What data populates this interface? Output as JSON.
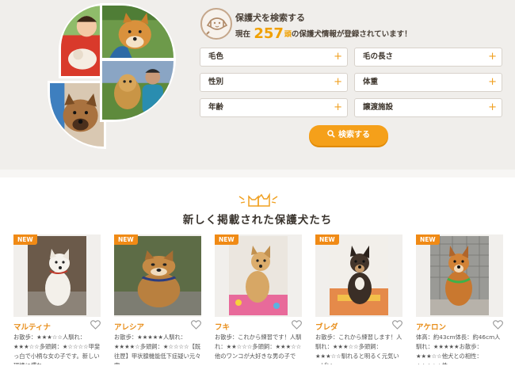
{
  "hero": {
    "search_title": "保護犬を検索する",
    "count_prefix": "現在",
    "count": "257",
    "count_unit": "頭",
    "count_suffix": "の保護犬情報が登録されています！",
    "filters": [
      {
        "label": "毛色"
      },
      {
        "label": "毛の長さ"
      },
      {
        "label": "性別"
      },
      {
        "label": "体重"
      },
      {
        "label": "年齢"
      },
      {
        "label": "譲渡施設"
      }
    ],
    "search_button": "検索する"
  },
  "section": {
    "title": "新しく掲載された保護犬たち"
  },
  "cards": [
    {
      "badge": "NEW",
      "name": "マルティナ",
      "desc": "お散歩：★★★☆☆人馴れ：★★★☆☆多頭飼：★☆☆☆☆甲斐っ白で小柄な女の子です。新しい環境に慣れ"
    },
    {
      "badge": "NEW",
      "name": "アレシア",
      "desc": "お散歩：★★★★★人馴れ：★★★★☆多頭飼：★☆☆☆☆【既往歴】甲状腺機能低下症疑い元々家"
    },
    {
      "badge": "NEW",
      "name": "フキ",
      "desc": "お散歩：これから練習です！人馴れ：★★☆☆☆多頭飼：★★★☆☆他のワンコが大好きな男の子で"
    },
    {
      "badge": "NEW",
      "name": "ブレダ",
      "desc": "お散歩：これから練習します！人馴れ：★★★☆☆多頭飼：★★★☆☆馴れると明るく元気いっぱい"
    },
    {
      "badge": "NEW",
      "name": "アケロン",
      "desc": "体高：約43cm体長：約46cm人馴れ：★★★★★お散歩：★★★☆☆他犬との相性：★★★☆☆性"
    }
  ],
  "colors": {
    "accent": "#f5a01a",
    "badge": "#f08a15",
    "name": "#e88e1a",
    "hero_bg": "#f0eeeb"
  }
}
